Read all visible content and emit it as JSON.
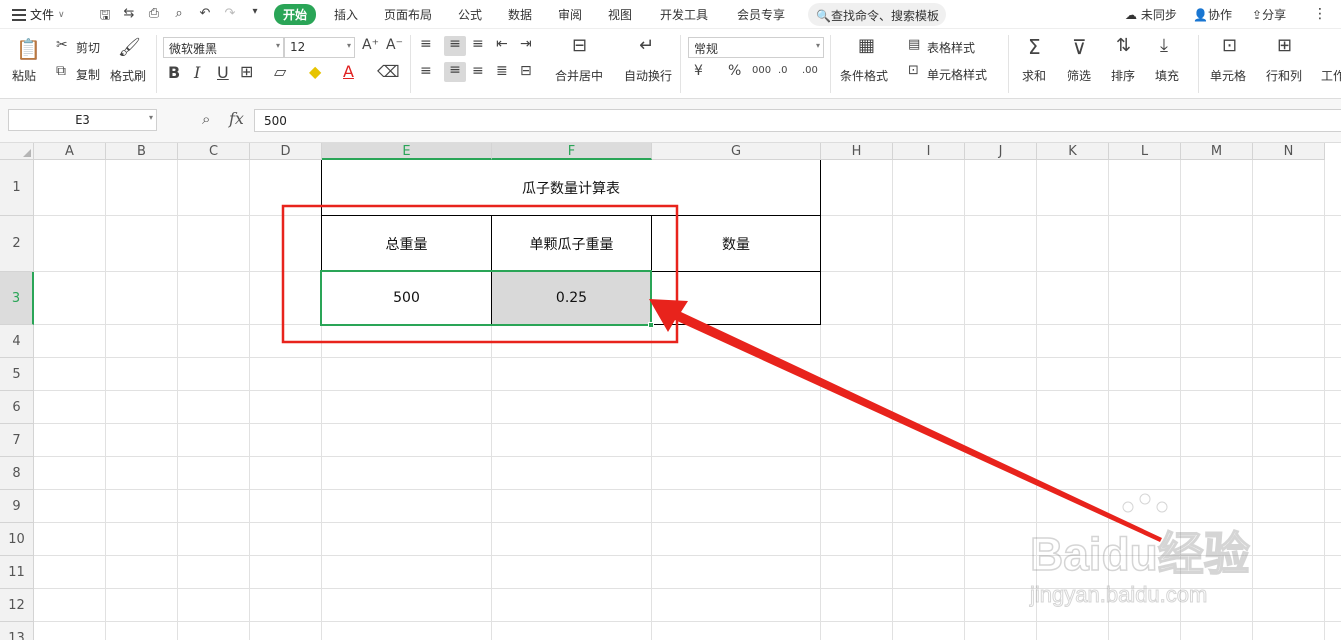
{
  "menubar": {
    "file_label": "文件",
    "tabs": [
      "开始",
      "插入",
      "页面布局",
      "公式",
      "数据",
      "审阅",
      "视图",
      "开发工具",
      "会员专享"
    ],
    "search_label": "查找命令、搜索模板",
    "sync_label": "未同步",
    "collab_label": "协作",
    "share_label": "分享"
  },
  "ribbon": {
    "paste": "粘贴",
    "cut": "剪切",
    "copy": "复制",
    "format_painter": "格式刷",
    "font_name": "微软雅黑",
    "font_size": "12",
    "merge_center": "合并居中",
    "wrap_text": "自动换行",
    "number_format": "常规",
    "conditional_format": "条件格式",
    "table_style": "表格样式",
    "cell_style": "单元格样式",
    "sum": "求和",
    "filter": "筛选",
    "sort": "排序",
    "fill": "填充",
    "cell": "单元格",
    "rows_cols": "行和列",
    "worksheet": "工作"
  },
  "formula_bar": {
    "name_box": "E3",
    "fx": "fx",
    "value": "500"
  },
  "sheet": {
    "columns": [
      "A",
      "B",
      "C",
      "D",
      "E",
      "F",
      "G",
      "H",
      "I",
      "J",
      "K",
      "L",
      "M",
      "N"
    ],
    "rows": [
      "1",
      "2",
      "3",
      "4",
      "5",
      "6",
      "7",
      "8",
      "9",
      "10",
      "11",
      "12",
      "13"
    ],
    "table": {
      "title": "瓜子数量计算表",
      "header_total": "总重量",
      "header_single": "单颗瓜子重量",
      "header_count": "数量",
      "value_total": "500",
      "value_single": "0.25",
      "value_count": ""
    }
  },
  "colors": {
    "accent_green": "#2aa557",
    "annotation_red": "#e8231c",
    "selected_cell_fill": "#d9d9d9"
  },
  "watermark": {
    "brand": "Baidu经验",
    "url": "jingyan.baidu.com"
  }
}
